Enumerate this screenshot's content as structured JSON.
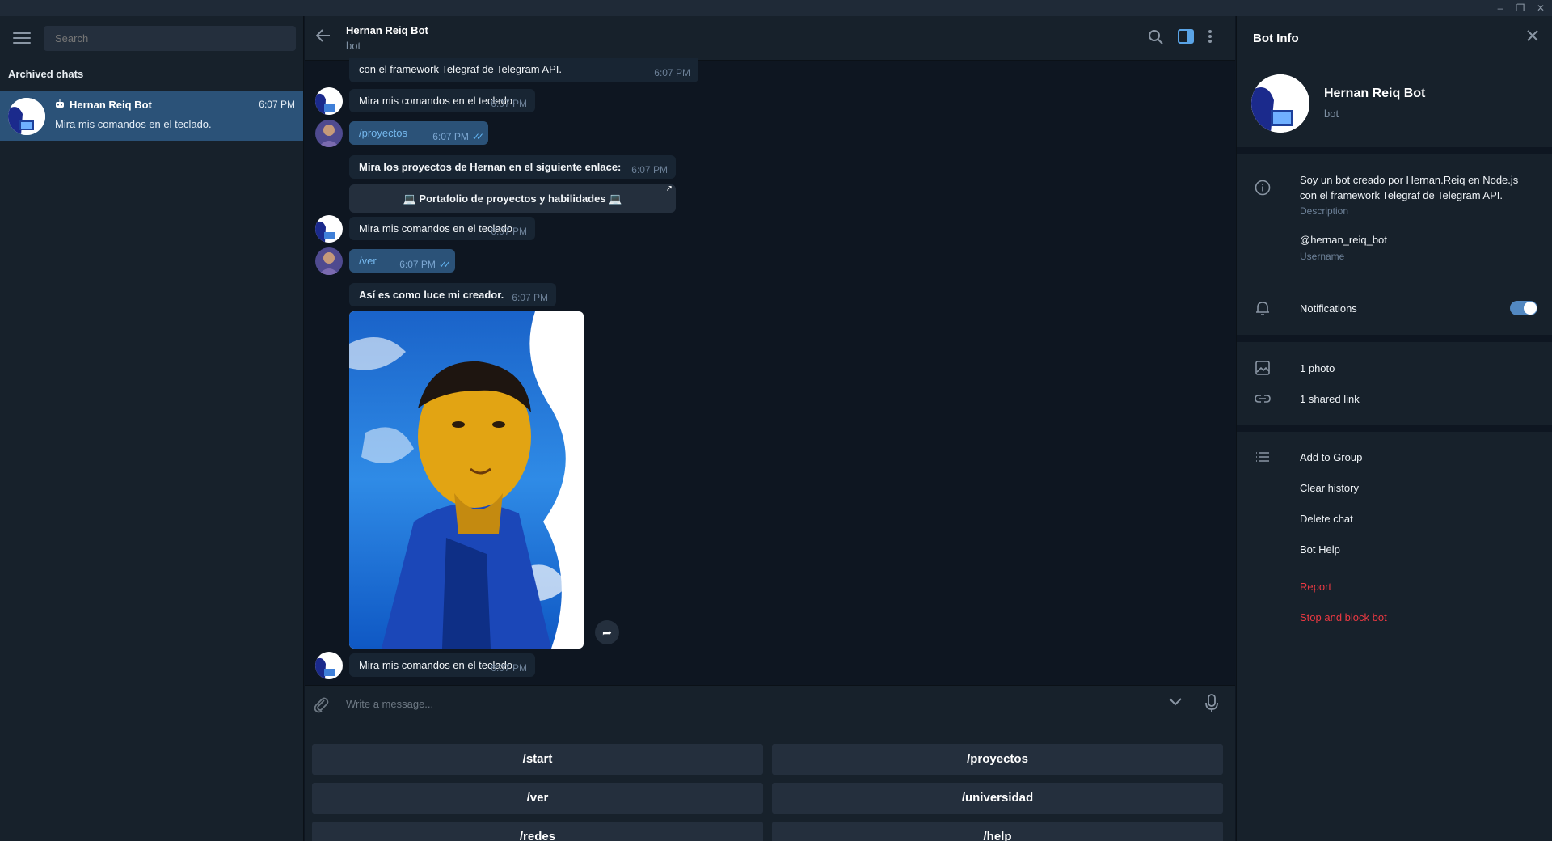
{
  "window": {
    "minimize": "–",
    "maximize": "❐",
    "close": "✕"
  },
  "left": {
    "search_placeholder": "Search",
    "section_title": "Archived chats",
    "chat": {
      "bot_icon": "bot-icon",
      "name": "Hernan Reiq Bot",
      "time": "6:07 PM",
      "preview": "Mira mis comandos en el teclado."
    }
  },
  "header": {
    "title": "Hernan Reiq Bot",
    "subtitle": "bot"
  },
  "messages": [
    {
      "text": "con el framework Telegraf de Telegram API.",
      "time": "6:07 PM"
    },
    {
      "text": "Mira mis comandos en el teclado.",
      "time": "6:07 PM"
    },
    {
      "text": "/proyectos",
      "time": "6:07 PM",
      "ticks": "✓✓"
    },
    {
      "text": "Mira los proyectos de Hernan en el siguiente enlace:",
      "time": "6:07 PM"
    },
    {
      "text": "💻 Portafolio de proyectos y habilidades 💻",
      "arrow": "↗"
    },
    {
      "text": "Mira mis comandos en el teclado.",
      "time": "6:07 PM"
    },
    {
      "text": "/ver",
      "time": "6:07 PM",
      "ticks": "✓✓"
    },
    {
      "text": "Así es como luce mi creador.",
      "time": "6:07 PM"
    },
    {
      "text": "Mira mis comandos en el teclado.",
      "time": "6:07 PM"
    }
  ],
  "forward_icon": "➦",
  "composer": {
    "placeholder": "Write a message..."
  },
  "keyboard": [
    "/start",
    "/proyectos",
    "/ver",
    "/universidad",
    "/redes",
    "/help"
  ],
  "info": {
    "title": "Bot Info",
    "name": "Hernan Reiq Bot",
    "subtitle": "bot",
    "description_line1": "Soy un bot creado por Hernan.Reiq en Node.js",
    "description_line2": "con el framework Telegraf de Telegram API.",
    "description_caption": "Description",
    "username": "@hernan_reiq_bot",
    "username_caption": "Username",
    "notifications": "Notifications",
    "notifications_on": true,
    "photos": "1 photo",
    "links": "1 shared link",
    "actions": [
      "Add to Group",
      "Clear history",
      "Delete chat",
      "Bot Help"
    ],
    "danger_actions": [
      "Report",
      "Stop and block bot"
    ]
  },
  "colors": {
    "accent": "#2b5278",
    "link": "#5288c1",
    "danger": "#ec3942",
    "background": "#0e1621",
    "panel": "#17212b"
  }
}
